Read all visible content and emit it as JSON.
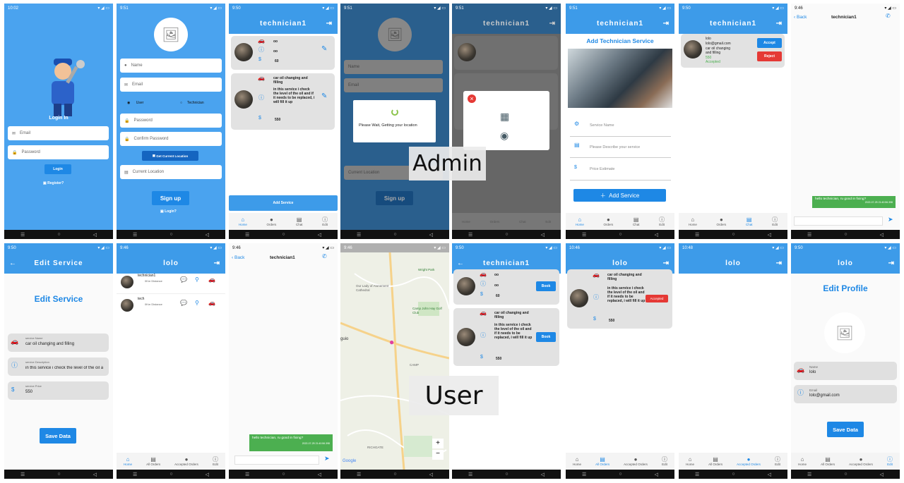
{
  "status": {
    "t1": "10:02",
    "t2": "9:51",
    "t3": "9:50",
    "t4": "9:51",
    "t5": "9:51",
    "t6": "9:51",
    "t7": "9:50",
    "t8": "9:46",
    "b1": "9:50",
    "b2": "9:46",
    "b3": "9:46",
    "b4": "9:46",
    "b5": "9:50",
    "b6": "10:46",
    "b7": "10:48",
    "b8": "9:50"
  },
  "login": {
    "title": "Login In",
    "email": "Email",
    "password": "Password",
    "btn": "Login",
    "register": "Register?"
  },
  "register": {
    "name": "Name",
    "email": "Email",
    "user": "User",
    "technician": "Technician",
    "password": "Password",
    "confirm": "Confirm Password",
    "get_loc": "Get Current Location",
    "loc": "Current Location",
    "signup": "Sign up",
    "login": "Login?"
  },
  "admin_home": {
    "title": "technician1",
    "s1": {
      "a": "oo",
      "b": "oo",
      "c": "60"
    },
    "s2": {
      "a": "car oil changing and filling",
      "b": "in this service i check the level of the oil and if it needs to be replaced, i will fill it up",
      "c": "550"
    },
    "add": "Add Service"
  },
  "nav_admin": {
    "home": "Home",
    "orders": "Orders",
    "chat": "Chat",
    "edit": "Edit"
  },
  "wait": {
    "msg": "Please Wait, Getting your location"
  },
  "add_service": {
    "title": "Add Technician Service",
    "name": "Service Name",
    "desc": "Please Describe your service",
    "price": "Price Estimate",
    "btn": "Add Service"
  },
  "orders_admin": {
    "title": "technician1",
    "name": "lolo",
    "email": "lolo@gmail.com",
    "service": "car oil changing and filling",
    "price": "550",
    "status": "Accepted",
    "accept": "Accept",
    "reject": "Reject"
  },
  "chat": {
    "back": "Back",
    "title": "technician1",
    "msg": "hello technician, ru good in fixing?",
    "time": "2022-07-25 21:40:56.398"
  },
  "labels": {
    "admin": "Admin",
    "user": "User"
  },
  "edit_service": {
    "title": "Edit Service",
    "heading": "Edit Service",
    "l1": "service Name",
    "v1": "car oil changing and filling",
    "l2": "service Description",
    "v2": "in this service i check the level of the oil a",
    "l3": "service Price",
    "v3": "550",
    "btn": "Save Data"
  },
  "user_home": {
    "title": "lolo",
    "t1": "technician1",
    "d1": "0Km Distance",
    "t2": "tech",
    "d2": "0Km Distance"
  },
  "nav_user": {
    "home": "Home",
    "all": "All Orders",
    "accepted": "Accepted Orders",
    "edit": "Edit"
  },
  "map": {
    "l1": "Wright Park",
    "l2": "Our Lady of Atonement Cathedral",
    "l3": "Camp John Hay Golf Club",
    "l4": "guio",
    "l5": "Google",
    "l6": "RICHGATE",
    "l7": "CAMP"
  },
  "tech_list": {
    "title": "technician1",
    "book": "Book"
  },
  "user_orders": {
    "title": "lolo",
    "status": "Accepted"
  },
  "profile": {
    "title": "lolo",
    "heading": "Edit Profile",
    "l1": "Name",
    "v1": "lolo",
    "l2": "Email",
    "v2": "lolo@gmail.com",
    "btn": "Save Data"
  }
}
